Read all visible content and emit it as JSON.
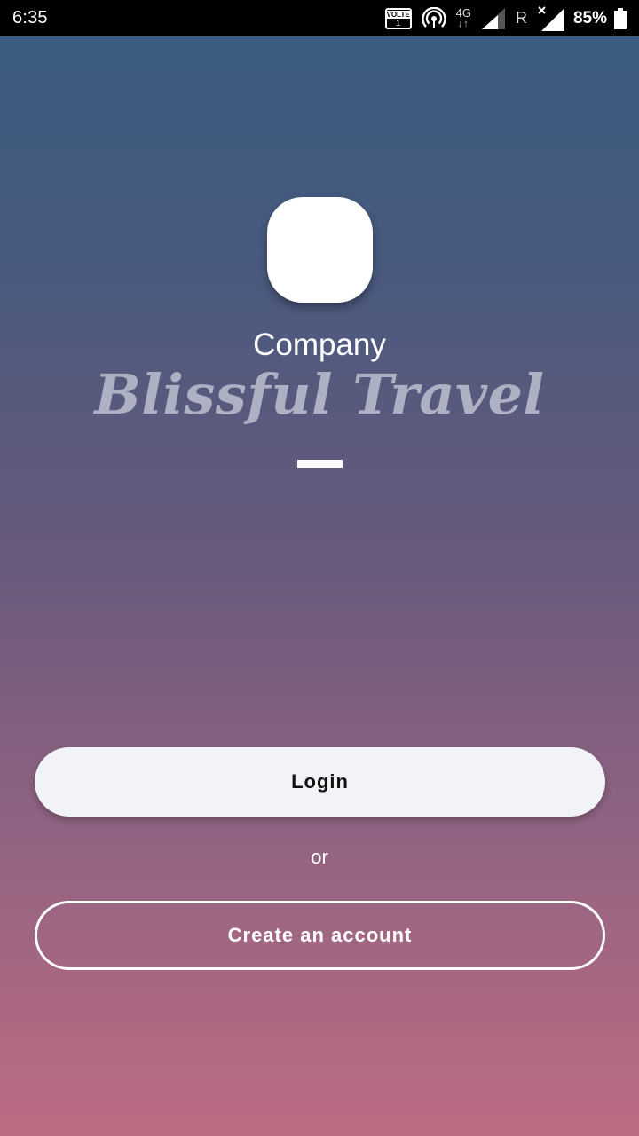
{
  "status_bar": {
    "time": "6:35",
    "volte_label": "VOLTE",
    "volte_sim": "1",
    "network_type": "4G",
    "network_arrows": "↓↑",
    "roaming": "R",
    "battery_percent": "85%",
    "battery_level": 0.85,
    "icons": [
      "volte-icon",
      "hotspot-icon",
      "network-4g-icon",
      "signal-icon",
      "roaming-indicator",
      "signal-no-service-icon",
      "battery-icon"
    ]
  },
  "branding": {
    "logo_icon": "app-logo",
    "company_label": "Company",
    "title": "Blissful Travel"
  },
  "actions": {
    "login_label": "Login",
    "separator_label": "or",
    "create_account_label": "Create an account"
  },
  "colors": {
    "gradient_top": "#385c80",
    "gradient_bottom": "#bd6b82",
    "title_color": "#aeb1c3",
    "login_bg": "#f2f3f7"
  }
}
